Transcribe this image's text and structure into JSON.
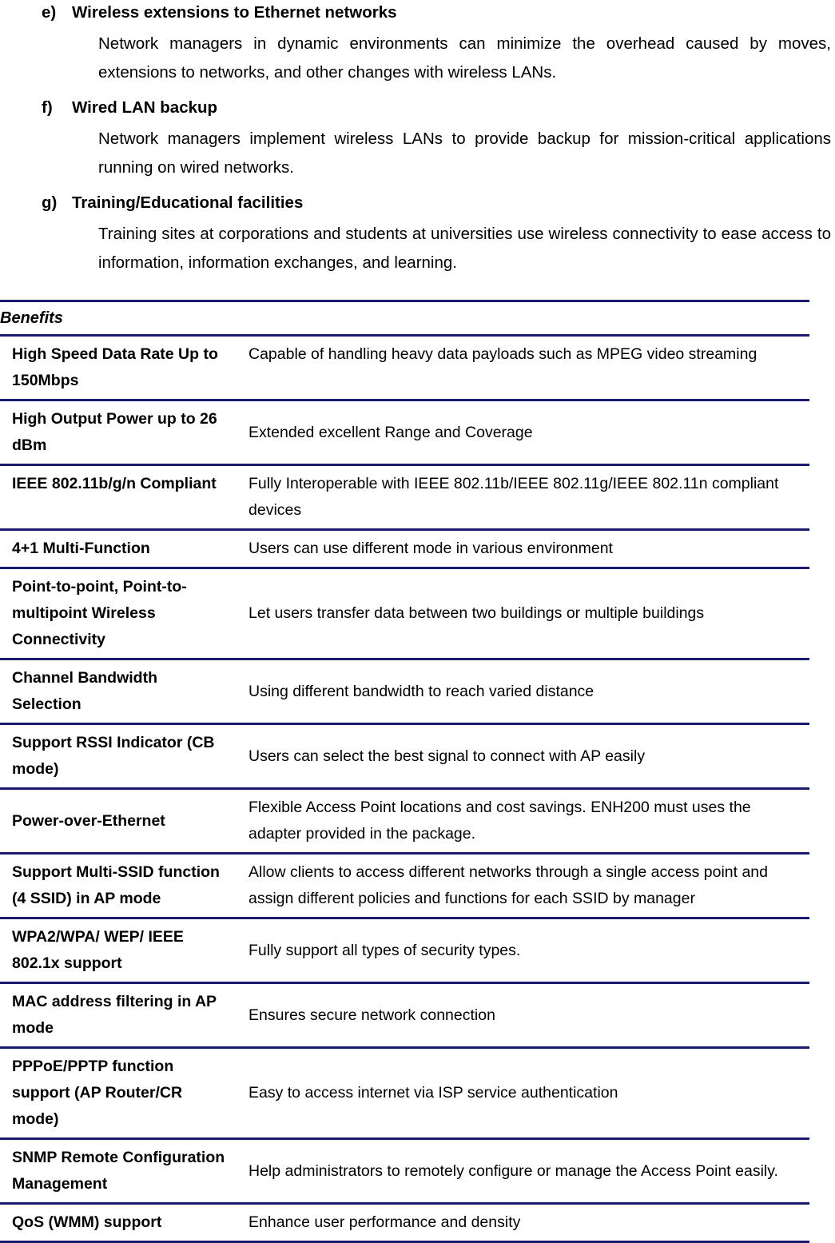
{
  "document": {
    "outline_items": [
      {
        "marker": "e)",
        "heading": "Wireless extensions to Ethernet networks",
        "body": "Network managers in dynamic environments can minimize the overhead caused by moves, extensions to networks, and other changes with wireless LANs."
      },
      {
        "marker": "f)",
        "heading": "Wired LAN backup",
        "body": "Network managers implement wireless LANs to provide backup for mission-critical applications running on wired networks."
      },
      {
        "marker": "g)",
        "heading": "Training/Educational facilities",
        "body": "Training sites at corporations and students at universities use wireless connectivity to ease access to information, information exchanges, and learning."
      }
    ],
    "table": {
      "title": "Benefits",
      "rule_color": "#1a1a6e",
      "rows": [
        {
          "feature": "High Speed Data Rate Up to 150Mbps",
          "description": "Capable of handling heavy data payloads such as MPEG video streaming",
          "feature_align": "top",
          "description_align": "top"
        },
        {
          "feature": "High Output Power up to 26 dBm",
          "description": "Extended excellent Range and Coverage",
          "feature_align": "top",
          "description_align": "middle"
        },
        {
          "feature": "IEEE 802.11b/g/n Compliant",
          "description": "Fully Interoperable with IEEE 802.11b/IEEE 802.11g/IEEE 802.11n compliant devices",
          "feature_align": "top",
          "description_align": "top"
        },
        {
          "feature": "4+1 Multi-Function",
          "description": "Users can use different mode in various environment",
          "feature_align": "top",
          "description_align": "top"
        },
        {
          "feature": "Point-to-point, Point-to-multipoint Wireless Connectivity",
          "description": "Let users transfer data between two buildings or multiple buildings",
          "feature_align": "top",
          "description_align": "middle"
        },
        {
          "feature": "Channel Bandwidth Selection",
          "description": "Using different bandwidth to reach varied distance",
          "feature_align": "top",
          "description_align": "middle"
        },
        {
          "feature": "Support RSSI Indicator (CB mode)",
          "description": "Users can select the best signal to connect with AP easily",
          "feature_align": "top",
          "description_align": "middle"
        },
        {
          "feature": "Power-over-Ethernet",
          "description": "Flexible Access Point locations and cost savings. ENH200 must uses the adapter provided in the package.",
          "feature_align": "middle",
          "description_align": "top"
        },
        {
          "feature": "Support Multi-SSID function (4 SSID) in AP mode",
          "description": "Allow clients to access different networks through a single access point and assign different policies and functions for each SSID by manager",
          "feature_align": "top",
          "description_align": "top"
        },
        {
          "feature": "WPA2/WPA/ WEP/ IEEE 802.1x support",
          "description": "Fully support all types of security types.",
          "feature_align": "top",
          "description_align": "middle"
        },
        {
          "feature": "MAC address filtering in AP mode",
          "description": "Ensures secure network connection",
          "feature_align": "top",
          "description_align": "middle"
        },
        {
          "feature": "PPPoE/PPTP function support (AP Router/CR mode)",
          "description": "Easy to access internet via ISP service authentication",
          "feature_align": "top",
          "description_align": "middle"
        },
        {
          "feature": "SNMP Remote Configuration Management",
          "description": "Help administrators to remotely configure or manage the Access Point easily.",
          "feature_align": "top",
          "description_align": "middle"
        },
        {
          "feature": "QoS (WMM) support",
          "description": "Enhance user performance and density",
          "feature_align": "middle",
          "description_align": "middle"
        }
      ]
    }
  }
}
